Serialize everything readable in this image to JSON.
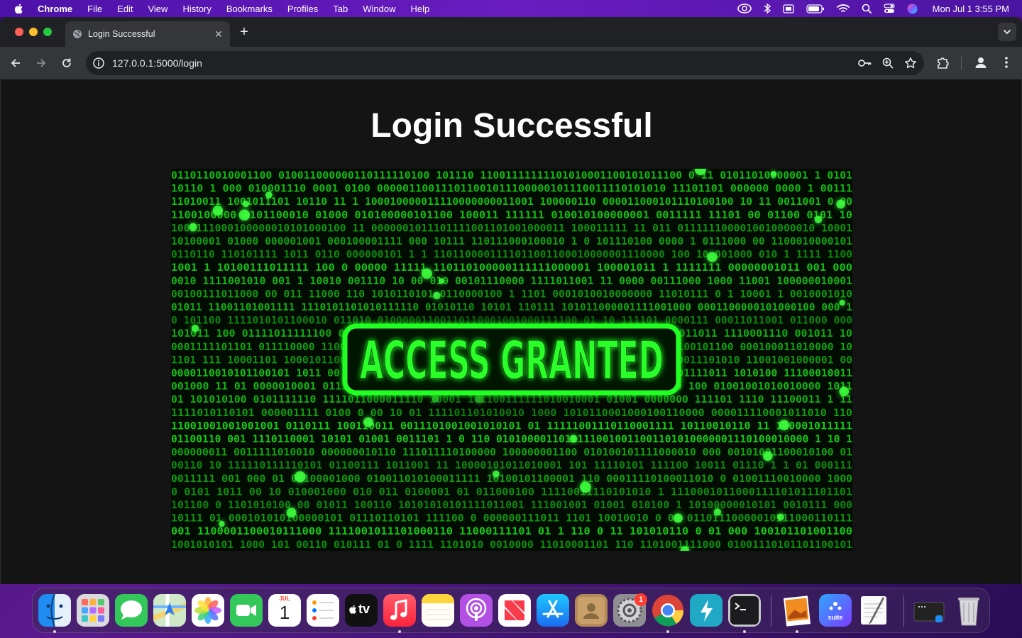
{
  "menubar": {
    "app_name": "Chrome",
    "items": [
      "File",
      "Edit",
      "View",
      "History",
      "Bookmarks",
      "Profiles",
      "Tab",
      "Window",
      "Help"
    ],
    "clock": "Mon Jul 1  3:55 PM"
  },
  "browser": {
    "tab": {
      "title": "Login Successful"
    },
    "url": "127.0.0.1:5000/login"
  },
  "page": {
    "title": "Login Successful",
    "banner_text": "ACCESS GRANTED",
    "colors": {
      "matrix_green": "#19e619",
      "banner_green": "#22ff22",
      "page_bg": "#141414"
    }
  },
  "dock": {
    "calendar": {
      "month": "JUL",
      "day": "1"
    },
    "tv_label": "tv",
    "settings_badge": "1",
    "suite_label": "suite",
    "apps": [
      "finder",
      "launchpad",
      "messages",
      "maps",
      "photos",
      "facetime",
      "calendar",
      "reminders",
      "tv",
      "music",
      "notes",
      "podcasts",
      "news",
      "app-store",
      "contacts",
      "system-settings",
      "chrome",
      "bolt",
      "terminal",
      "preview",
      "suite",
      "textedit",
      "screen",
      "trash"
    ]
  }
}
